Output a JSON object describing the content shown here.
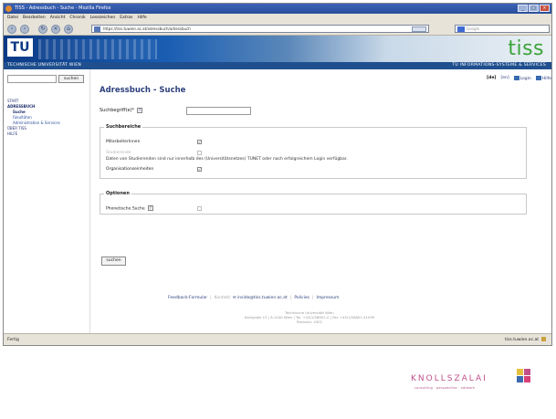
{
  "browser": {
    "title": "TISS - Adressbuch - Suche - Mozilla Firefox",
    "menu": [
      "Datei",
      "Bearbeiten",
      "Ansicht",
      "Chronik",
      "Lesezeichen",
      "Extras",
      "Hilfe"
    ],
    "url": "https://tiss.tuwien.ac.at/adressbuch/adressbuch",
    "search_placeholder": "Google",
    "status_left": "Fertig",
    "status_right": "tiss.tuwien.ac.at"
  },
  "header": {
    "tu_logo": "TU",
    "university": "TECHNISCHE UNIVERSITÄT WIEN",
    "tiss_logo": "tiss",
    "dept": "TU INFORMATIONS-SYSTEME & SERVICES"
  },
  "sidebar": {
    "search_button": "suchen",
    "items": [
      {
        "label": "START",
        "level": 1
      },
      {
        "label": "ADRESSBUCH",
        "level": 1,
        "active": true
      },
      {
        "label": "Suche",
        "level": 2,
        "active": true
      },
      {
        "label": "Fakultäten",
        "level": 2
      },
      {
        "label": "Administration & Services",
        "level": 2
      },
      {
        "label": "ÜBER TISS",
        "level": 1
      },
      {
        "label": "HILFE",
        "level": 1
      }
    ]
  },
  "toplinks": {
    "lang_de": "[de]",
    "lang_en": "[en]",
    "login": "Login",
    "help": "Hilfe"
  },
  "page": {
    "title": "Adressbuch - Suche",
    "search_label": "Suchbegriff(e)*",
    "help_icon": "?",
    "bereiche": {
      "legend": "Suchbereiche",
      "staff": "MitarbeiterInnen",
      "students": "Studierende",
      "notice": "Daten von Studierenden sind nur innerhalb des (Universitätsnetzes) TUNET oder nach erfolgreichem Login verfügbar.",
      "orgs": "Organisationseinheiten"
    },
    "optionen": {
      "legend": "Optionen",
      "phonetic": "Phonetische Suche"
    },
    "submit": "suchen"
  },
  "footer": {
    "feedback": "Feedback-Formular",
    "kontakt": "Kontakt:",
    "email": "inside@tiss.tuwien.ac.at",
    "policies": "Policies",
    "impressum": "Impressum",
    "address_line1": "Technische Universität Wien",
    "address_line2": "Karlsplatz 13 | A-1040 Wien | Tel. +43/1/58801-0 | Fax +43/1/58801-41099",
    "address_line3": "Revision: 4302"
  },
  "branding": {
    "company": "KNOLLSZALAI",
    "tagline": "consulting · perspective · network",
    "colors": [
      "#e5c13d",
      "#c0508a",
      "#3a6ab0",
      "#d8407a"
    ]
  }
}
